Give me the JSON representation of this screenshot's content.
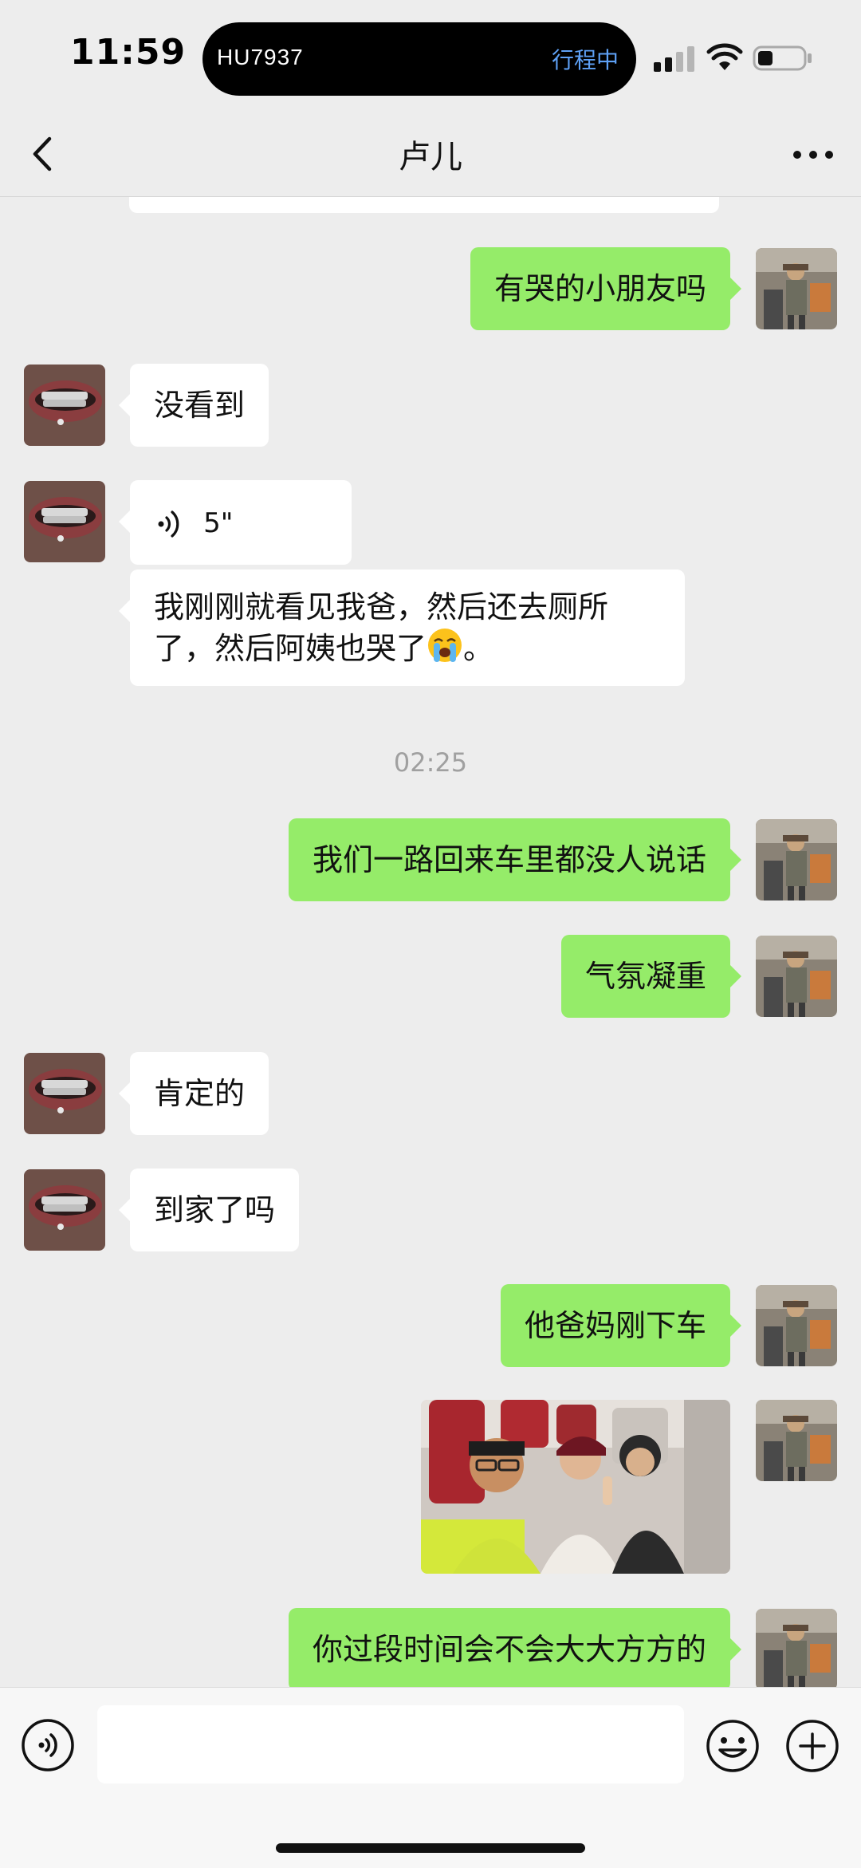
{
  "status_bar": {
    "time": "11:59",
    "island_flight": "HU7937",
    "island_status": "行程中",
    "icons": [
      "signal-icon",
      "wifi-icon",
      "battery-icon"
    ]
  },
  "nav": {
    "title": "卢儿",
    "back_icon": "chevron-left-icon",
    "more_icon": "more-dots-icon"
  },
  "messages": [
    {
      "from": "me",
      "type": "text",
      "text": "有哭的小朋友吗"
    },
    {
      "from": "contact",
      "type": "text",
      "text": "没看到"
    },
    {
      "from": "contact",
      "type": "voice",
      "duration": "5\""
    },
    {
      "from": "contact",
      "type": "text",
      "text": "我刚刚就看见我爸，然后还去厕所了，然后阿姨也哭了",
      "text_end": "。",
      "emoji": "loudly-crying-face"
    },
    {
      "type": "timestamp",
      "text": "02:25"
    },
    {
      "from": "me",
      "type": "text",
      "text": "我们一路回来车里都没人说话"
    },
    {
      "from": "me",
      "type": "text",
      "text": "气氛凝重"
    },
    {
      "from": "contact",
      "type": "text",
      "text": "肯定的"
    },
    {
      "from": "contact",
      "type": "text",
      "text": "到家了吗"
    },
    {
      "from": "me",
      "type": "text",
      "text": "他爸妈刚下车"
    },
    {
      "from": "me",
      "type": "image",
      "description": "photo"
    },
    {
      "from": "me",
      "type": "text",
      "text": "你过段时间会不会大大方方的"
    }
  ],
  "input_bar": {
    "placeholder": "",
    "icons": [
      "voice-toggle-icon",
      "emoji-icon",
      "plus-icon"
    ]
  },
  "colors": {
    "background": "#ededed",
    "outgoing_bubble": "#95ec69",
    "incoming_bubble": "#ffffff",
    "island_status": "#5ea1f6"
  }
}
